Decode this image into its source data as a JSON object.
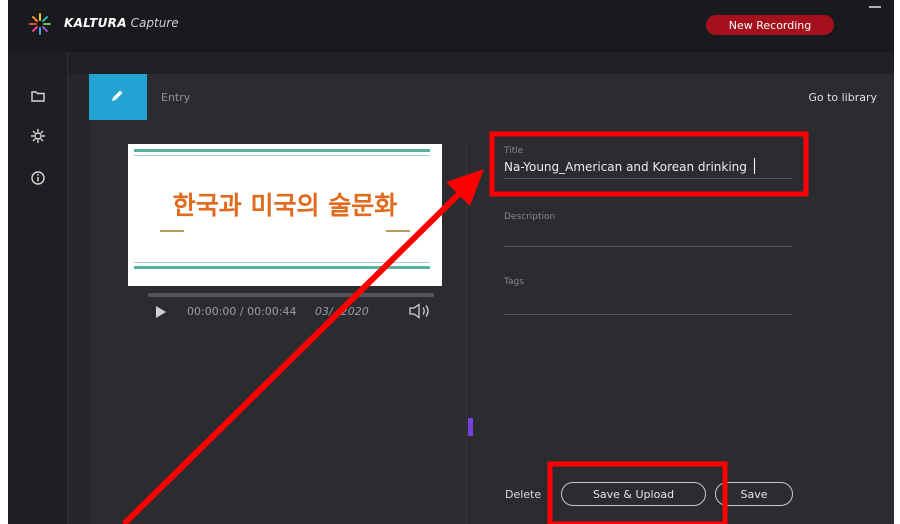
{
  "app": {
    "brand_name": "KALTURA",
    "brand_product": "Capture",
    "new_recording_label": "New Recording"
  },
  "sidebar": {
    "items": [
      {
        "icon": "folder-icon"
      },
      {
        "icon": "gear-icon"
      },
      {
        "icon": "info-icon"
      }
    ]
  },
  "entry": {
    "tab_label": "Entry",
    "library_link": "Go to library"
  },
  "preview": {
    "slide_text": "한국과 미국의 술문화",
    "time": "00:00:00 / 00:00:44",
    "date": "03/  /2020"
  },
  "form": {
    "title_label": "Title",
    "title_value": "Na-Young_American and Korean drinking",
    "description_label": "Description",
    "description_value": "",
    "tags_label": "Tags",
    "tags_value": ""
  },
  "actions": {
    "delete_label": "Delete",
    "save_upload_label": "Save & Upload",
    "save_label": "Save"
  },
  "colors": {
    "accent": "#23a3d3",
    "recording": "#a4101b",
    "annotation": "#ff0000"
  }
}
